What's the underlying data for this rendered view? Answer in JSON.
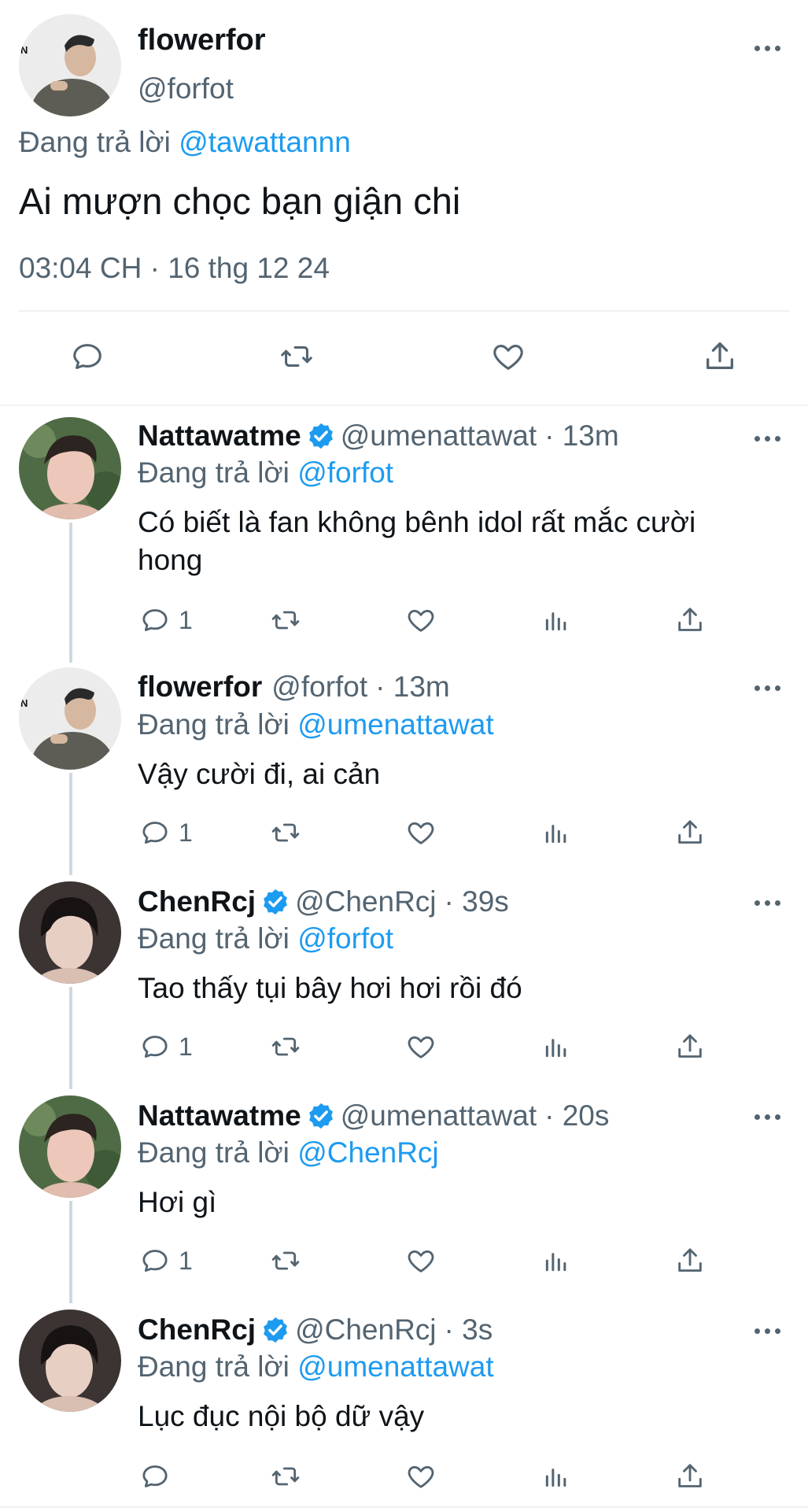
{
  "main_tweet": {
    "display_name": "flowerfor",
    "handle": "@forfot",
    "replying_prefix": "Đang trả lời",
    "replying_to": "@tawattannn",
    "text": "Ai mượn chọc bạn giận chi",
    "timestamp": "03:04 CH · 16 thg 12 24",
    "actions": [
      "reply-icon",
      "retweet-icon",
      "like-icon",
      "share-icon"
    ]
  },
  "replies": [
    {
      "display_name": "Nattawatme",
      "verified": true,
      "handle": "@umenattawat",
      "time": "· 13m",
      "replying_prefix": "Đang trả lời",
      "replying_to": "@forfot",
      "text_lines": [
        "Có biết là fan không bênh idol rất mắc cười",
        "hong"
      ],
      "reply_count": "1"
    },
    {
      "display_name": "flowerfor",
      "verified": false,
      "handle": "@forfot",
      "time": "· 13m",
      "replying_prefix": "Đang trả lời",
      "replying_to": "@umenattawat",
      "text_lines": [
        "Vậy cười đi, ai cản"
      ],
      "reply_count": "1"
    },
    {
      "display_name": "ChenRcj",
      "verified": true,
      "handle": "@ChenRcj",
      "time": "· 39s",
      "replying_prefix": "Đang trả lời",
      "replying_to": "@forfot",
      "text_lines": [
        "Tao thấy tụi bây hơi hơi rồi đó"
      ],
      "reply_count": "1"
    },
    {
      "display_name": "Nattawatme",
      "verified": true,
      "handle": "@umenattawat",
      "time": "· 20s",
      "replying_prefix": "Đang trả lời",
      "replying_to": "@ChenRcj",
      "text_lines": [
        "Hơi gì"
      ],
      "reply_count": "1"
    },
    {
      "display_name": "ChenRcj",
      "verified": true,
      "handle": "@ChenRcj",
      "time": "· 3s",
      "replying_prefix": "Đang trả lời",
      "replying_to": "@umenattawat",
      "text_lines": [
        "Lục đục nội bộ dữ vậy"
      ],
      "reply_count": ""
    }
  ],
  "colors": {
    "link": "#1d9bf0",
    "secondary": "#536471",
    "verified": "#1d9bf0"
  }
}
